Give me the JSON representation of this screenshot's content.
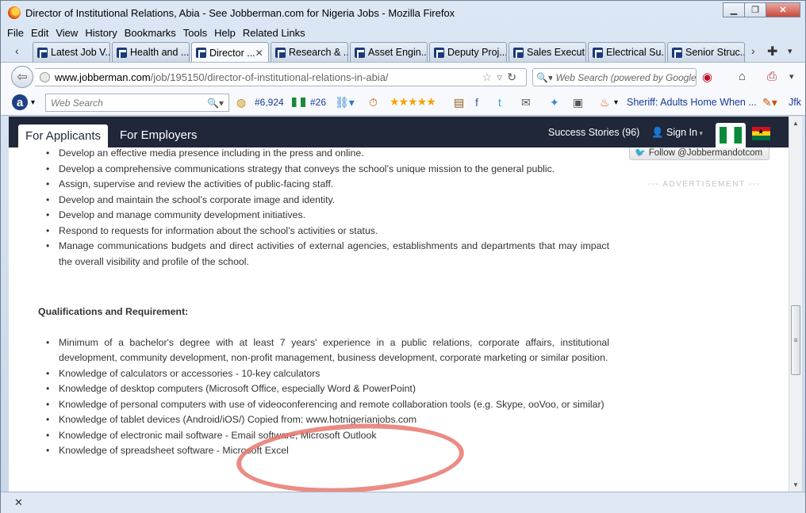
{
  "window": {
    "title": "Director of Institutional Relations, Abia - See Jobberman.com for Nigeria Jobs - Mozilla Firefox"
  },
  "menu": [
    "File",
    "Edit",
    "View",
    "History",
    "Bookmarks",
    "Tools",
    "Help",
    "Related Links"
  ],
  "tabs": [
    {
      "label": "Latest Job V...",
      "active": false
    },
    {
      "label": "Health and ...",
      "active": false
    },
    {
      "label": "Director ...",
      "active": true
    },
    {
      "label": "Research & ...",
      "active": false
    },
    {
      "label": "Asset Engin...",
      "active": false
    },
    {
      "label": "Deputy Proj...",
      "active": false
    },
    {
      "label": "Sales Execut...",
      "active": false
    },
    {
      "label": "Electrical Su...",
      "active": false
    },
    {
      "label": "Senior Struc...",
      "active": false
    }
  ],
  "navbar": {
    "url_domain": "www.jobberman.com",
    "url_path": "/job/195150/director-of-institutional-relations-in-abia/",
    "search_placeholder": "Web Search (powered by Google)"
  },
  "addon_toolbar": {
    "search_placeholder": "Web Search",
    "rank_global": "#6,924",
    "rank_country": "#26",
    "news_link": "Sheriff: Adults Home When ...",
    "overflow_link": "Jfk"
  },
  "site_header": {
    "tab_applicants": "For Applicants",
    "tab_employers": "For Employers",
    "success_stories": "Success Stories (96)",
    "sign_in": "Sign In"
  },
  "sidebar": {
    "follow_button": "Follow @Jobbermandotcom",
    "advertisement_label": "--- ADVERTISEMENT ---"
  },
  "responsibilities": [
    "Develop an effective media presence including in the press and online.",
    "Develop a comprehensive communications strategy that conveys the school’s unique mission to the general public.",
    "Assign, supervise and review the activities of public-facing staff.",
    "Develop and maintain the school’s corporate image and identity.",
    "Develop and manage community development initiatives.",
    "Respond to requests for information about the school’s activities or status.",
    "Manage communications budgets and direct activities of external agencies, establishments and departments that may impact the overall visibility and profile of the school."
  ],
  "qualifications_heading": "Qualifications and Requirement:",
  "qualifications": [
    "Minimum of a bachelor's degree with at least 7 years' experience in a public relations, corporate affairs, institutional development, community development, non-profit management, business development, corporate marketing or similar position.",
    "Knowledge of calculators or accessories - 10-key calculators",
    "Knowledge of desktop computers (Microsoft Office, especially Word & PowerPoint)",
    "Knowledge of personal computers with use of videoconferencing and remote collaboration tools (e.g. Skype, ooVoo, or similar)",
    "Knowledge of tablet devices (Android/iOS/) Copied from: www.hotnigerianjobs.com",
    "Knowledge of electronic mail software - Email software; Microsoft Outlook",
    "Knowledge of spreadsheet software - Microsoft Excel"
  ]
}
